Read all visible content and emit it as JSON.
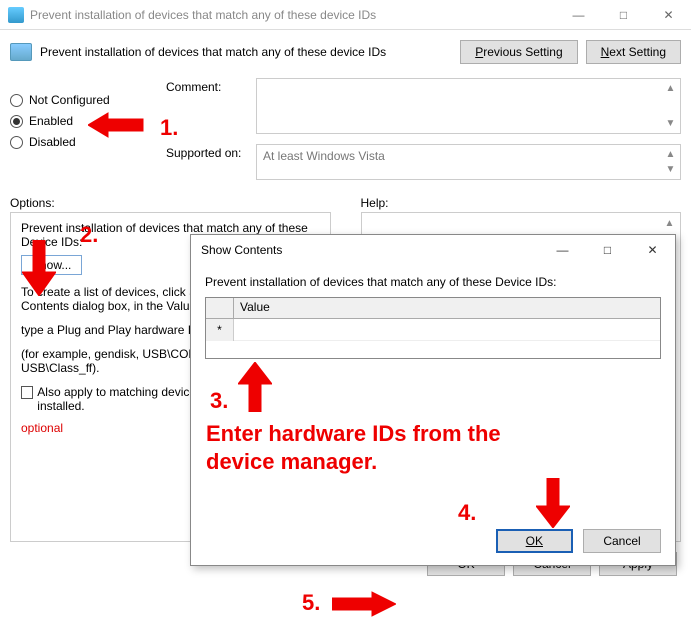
{
  "window": {
    "title": "Prevent installation of devices that match any of these device IDs",
    "minimize": "—",
    "maximize": "□",
    "close": "✕"
  },
  "header": {
    "policy_title": "Prevent installation of devices that match any of these device IDs",
    "prev_label": "Previous Setting",
    "next_label": "Next Setting"
  },
  "state": {
    "not_configured": "Not Configured",
    "enabled": "Enabled",
    "disabled": "Disabled",
    "selected": "enabled"
  },
  "fields": {
    "comment_label": "Comment:",
    "supported_label": "Supported on:",
    "supported_value": "At least Windows Vista"
  },
  "sections": {
    "options_label": "Options:",
    "help_label": "Help:"
  },
  "options_pane": {
    "heading": "Prevent installation of devices that match any of these Device IDs:",
    "show_btn": "Show...",
    "create_list": "To create a list of devices, click Show. In the Show Contents dialog box, in the Value column,",
    "type_pnp": "type a Plug and Play hardware ID or compatible ID",
    "example": "(for example, gendisk, USB\\COMPOSITE, USB\\Class_ff).",
    "also_apply": "Also apply to matching devices that are already installed.",
    "optional": "optional"
  },
  "main_buttons": {
    "ok": "OK",
    "cancel": "Cancel",
    "apply": "Apply"
  },
  "dialog": {
    "title": "Show Contents",
    "minimize": "—",
    "maximize": "□",
    "close": "✕",
    "heading": "Prevent installation of devices that match any of these Device IDs:",
    "col_value": "Value",
    "row_marker": "*",
    "ok": "OK",
    "cancel": "Cancel"
  },
  "annotations": {
    "n1": "1.",
    "n2": "2.",
    "n3": "3.",
    "n4": "4.",
    "n5": "5.",
    "text3": "Enter hardware IDs from the device manager."
  }
}
